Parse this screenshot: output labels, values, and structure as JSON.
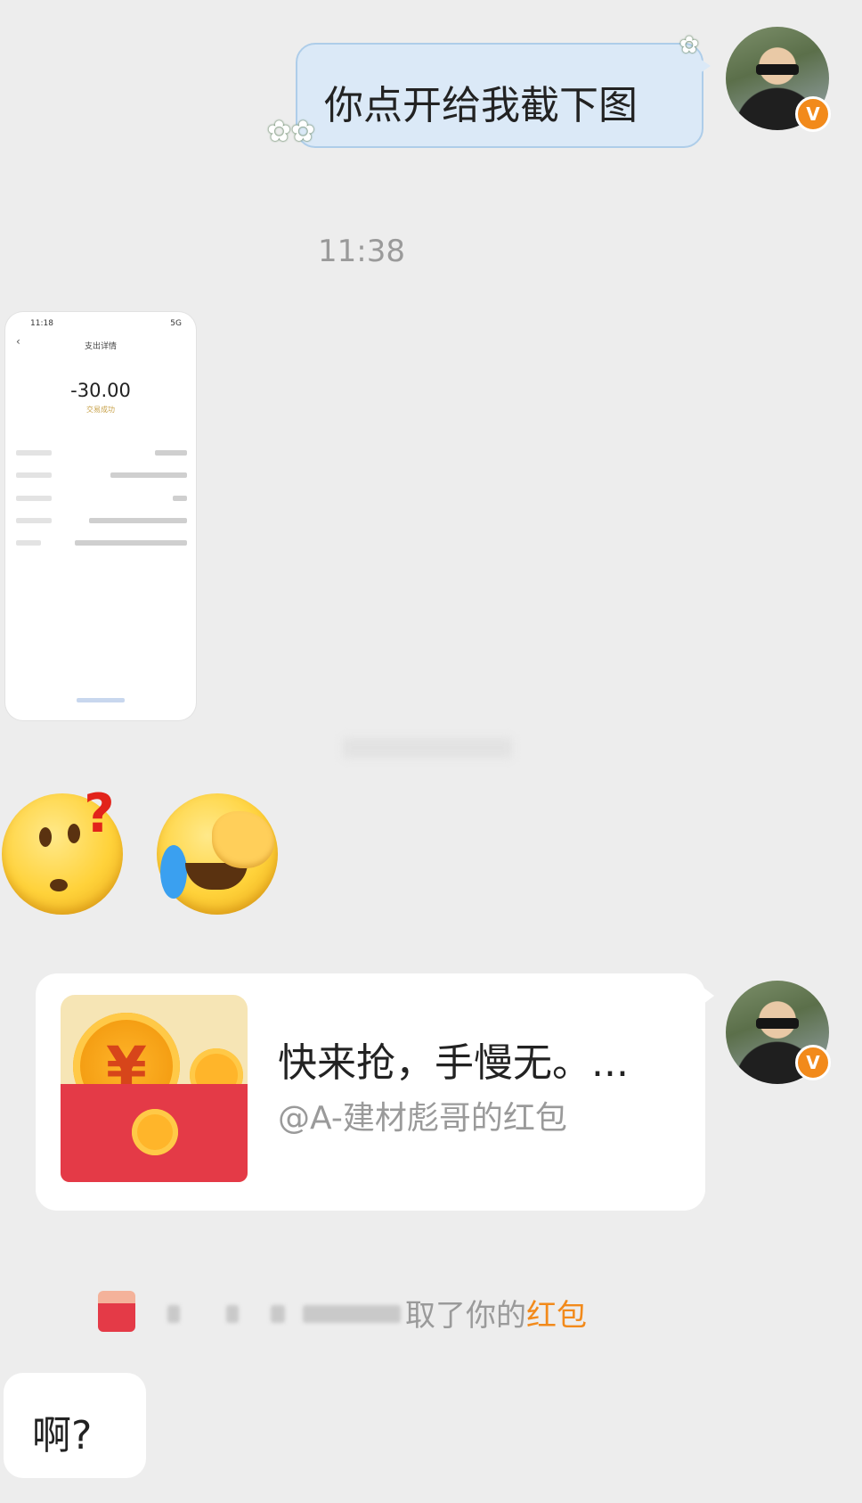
{
  "messages": {
    "outgoing_text": "你点开给我截下图",
    "timestamp": "11:38",
    "screenshot": {
      "status_time": "11:18",
      "status_right": "5G",
      "title": "支出详情",
      "amount": "-30.00",
      "status": "交易成功"
    },
    "emoji_1": "thinking-question-emoji",
    "emoji_2": "facepalm-laughing-emoji",
    "red_packet": {
      "title": "快来抢，手慢无。...",
      "subtitle": "@A-建材彪哥的红包"
    },
    "notice": {
      "text_before": "取了你的",
      "text_highlight": "红包"
    },
    "reply_text": "啊?"
  },
  "avatar": {
    "badge": "V",
    "badge_color": "#f28a1b"
  }
}
